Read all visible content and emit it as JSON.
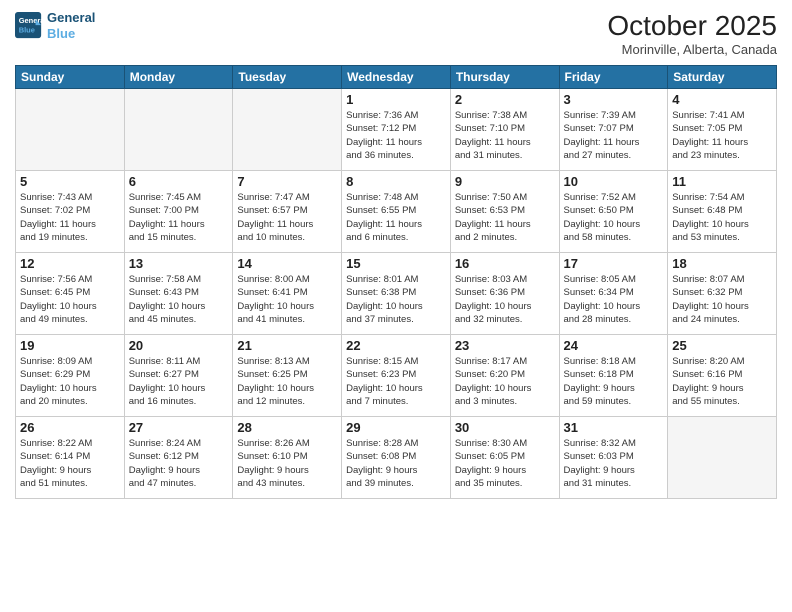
{
  "header": {
    "logo_line1": "General",
    "logo_line2": "Blue",
    "title": "October 2025",
    "subtitle": "Morinville, Alberta, Canada"
  },
  "days_of_week": [
    "Sunday",
    "Monday",
    "Tuesday",
    "Wednesday",
    "Thursday",
    "Friday",
    "Saturday"
  ],
  "weeks": [
    [
      {
        "day": "",
        "info": ""
      },
      {
        "day": "",
        "info": ""
      },
      {
        "day": "",
        "info": ""
      },
      {
        "day": "1",
        "info": "Sunrise: 7:36 AM\nSunset: 7:12 PM\nDaylight: 11 hours\nand 36 minutes."
      },
      {
        "day": "2",
        "info": "Sunrise: 7:38 AM\nSunset: 7:10 PM\nDaylight: 11 hours\nand 31 minutes."
      },
      {
        "day": "3",
        "info": "Sunrise: 7:39 AM\nSunset: 7:07 PM\nDaylight: 11 hours\nand 27 minutes."
      },
      {
        "day": "4",
        "info": "Sunrise: 7:41 AM\nSunset: 7:05 PM\nDaylight: 11 hours\nand 23 minutes."
      }
    ],
    [
      {
        "day": "5",
        "info": "Sunrise: 7:43 AM\nSunset: 7:02 PM\nDaylight: 11 hours\nand 19 minutes."
      },
      {
        "day": "6",
        "info": "Sunrise: 7:45 AM\nSunset: 7:00 PM\nDaylight: 11 hours\nand 15 minutes."
      },
      {
        "day": "7",
        "info": "Sunrise: 7:47 AM\nSunset: 6:57 PM\nDaylight: 11 hours\nand 10 minutes."
      },
      {
        "day": "8",
        "info": "Sunrise: 7:48 AM\nSunset: 6:55 PM\nDaylight: 11 hours\nand 6 minutes."
      },
      {
        "day": "9",
        "info": "Sunrise: 7:50 AM\nSunset: 6:53 PM\nDaylight: 11 hours\nand 2 minutes."
      },
      {
        "day": "10",
        "info": "Sunrise: 7:52 AM\nSunset: 6:50 PM\nDaylight: 10 hours\nand 58 minutes."
      },
      {
        "day": "11",
        "info": "Sunrise: 7:54 AM\nSunset: 6:48 PM\nDaylight: 10 hours\nand 53 minutes."
      }
    ],
    [
      {
        "day": "12",
        "info": "Sunrise: 7:56 AM\nSunset: 6:45 PM\nDaylight: 10 hours\nand 49 minutes."
      },
      {
        "day": "13",
        "info": "Sunrise: 7:58 AM\nSunset: 6:43 PM\nDaylight: 10 hours\nand 45 minutes."
      },
      {
        "day": "14",
        "info": "Sunrise: 8:00 AM\nSunset: 6:41 PM\nDaylight: 10 hours\nand 41 minutes."
      },
      {
        "day": "15",
        "info": "Sunrise: 8:01 AM\nSunset: 6:38 PM\nDaylight: 10 hours\nand 37 minutes."
      },
      {
        "day": "16",
        "info": "Sunrise: 8:03 AM\nSunset: 6:36 PM\nDaylight: 10 hours\nand 32 minutes."
      },
      {
        "day": "17",
        "info": "Sunrise: 8:05 AM\nSunset: 6:34 PM\nDaylight: 10 hours\nand 28 minutes."
      },
      {
        "day": "18",
        "info": "Sunrise: 8:07 AM\nSunset: 6:32 PM\nDaylight: 10 hours\nand 24 minutes."
      }
    ],
    [
      {
        "day": "19",
        "info": "Sunrise: 8:09 AM\nSunset: 6:29 PM\nDaylight: 10 hours\nand 20 minutes."
      },
      {
        "day": "20",
        "info": "Sunrise: 8:11 AM\nSunset: 6:27 PM\nDaylight: 10 hours\nand 16 minutes."
      },
      {
        "day": "21",
        "info": "Sunrise: 8:13 AM\nSunset: 6:25 PM\nDaylight: 10 hours\nand 12 minutes."
      },
      {
        "day": "22",
        "info": "Sunrise: 8:15 AM\nSunset: 6:23 PM\nDaylight: 10 hours\nand 7 minutes."
      },
      {
        "day": "23",
        "info": "Sunrise: 8:17 AM\nSunset: 6:20 PM\nDaylight: 10 hours\nand 3 minutes."
      },
      {
        "day": "24",
        "info": "Sunrise: 8:18 AM\nSunset: 6:18 PM\nDaylight: 9 hours\nand 59 minutes."
      },
      {
        "day": "25",
        "info": "Sunrise: 8:20 AM\nSunset: 6:16 PM\nDaylight: 9 hours\nand 55 minutes."
      }
    ],
    [
      {
        "day": "26",
        "info": "Sunrise: 8:22 AM\nSunset: 6:14 PM\nDaylight: 9 hours\nand 51 minutes."
      },
      {
        "day": "27",
        "info": "Sunrise: 8:24 AM\nSunset: 6:12 PM\nDaylight: 9 hours\nand 47 minutes."
      },
      {
        "day": "28",
        "info": "Sunrise: 8:26 AM\nSunset: 6:10 PM\nDaylight: 9 hours\nand 43 minutes."
      },
      {
        "day": "29",
        "info": "Sunrise: 8:28 AM\nSunset: 6:08 PM\nDaylight: 9 hours\nand 39 minutes."
      },
      {
        "day": "30",
        "info": "Sunrise: 8:30 AM\nSunset: 6:05 PM\nDaylight: 9 hours\nand 35 minutes."
      },
      {
        "day": "31",
        "info": "Sunrise: 8:32 AM\nSunset: 6:03 PM\nDaylight: 9 hours\nand 31 minutes."
      },
      {
        "day": "",
        "info": ""
      }
    ]
  ]
}
